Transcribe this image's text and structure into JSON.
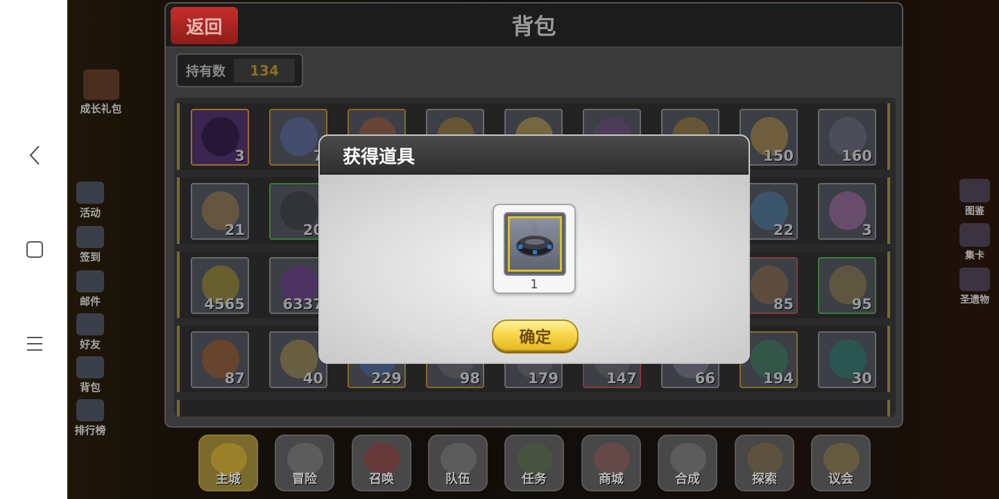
{
  "android_nav": {
    "back_icon": "chevron-left-icon",
    "recent_icon": "square-icon",
    "menu_icon": "hamburger-icon"
  },
  "left_menu": {
    "growth_pack": "成长礼包",
    "items": [
      {
        "label": "活动",
        "icon": "activity-icon"
      },
      {
        "label": "签到",
        "icon": "checkin-icon"
      },
      {
        "label": "邮件",
        "icon": "mail-icon"
      },
      {
        "label": "好友",
        "icon": "friends-icon"
      },
      {
        "label": "背包",
        "icon": "backpack-icon"
      },
      {
        "label": "排行榜",
        "icon": "leaderboard-icon"
      }
    ]
  },
  "right_menu": {
    "items": [
      {
        "label": "图鉴",
        "icon": "book-icon"
      },
      {
        "label": "集卡",
        "icon": "card-collect-icon"
      },
      {
        "label": "圣遗物",
        "icon": "relic-icon"
      }
    ]
  },
  "bag": {
    "back_label": "返回",
    "title": "背包",
    "count_label": "持有数",
    "count_value": "134",
    "rows": [
      [
        "3",
        "7",
        "",
        "",
        "",
        "",
        "",
        "150",
        "160"
      ],
      [
        "21",
        "20",
        "",
        "",
        "",
        "",
        "",
        "22",
        "3"
      ],
      [
        "4565",
        "6337",
        "",
        "",
        "",
        "",
        "",
        "85",
        "95"
      ],
      [
        "87",
        "40",
        "229",
        "98",
        "179",
        "147",
        "66",
        "194",
        "30"
      ]
    ]
  },
  "bottom_tabs": [
    {
      "label": "主城",
      "active": true
    },
    {
      "label": "冒险",
      "active": false
    },
    {
      "label": "召唤",
      "active": false
    },
    {
      "label": "队伍",
      "active": false
    },
    {
      "label": "任务",
      "active": false
    },
    {
      "label": "商城",
      "active": false
    },
    {
      "label": "合成",
      "active": false
    },
    {
      "label": "探索",
      "active": false
    },
    {
      "label": "议会",
      "active": false
    }
  ],
  "modal": {
    "title": "获得道具",
    "item_icon": "bracelet-icon",
    "item_qty": "1",
    "confirm_label": "确定"
  }
}
